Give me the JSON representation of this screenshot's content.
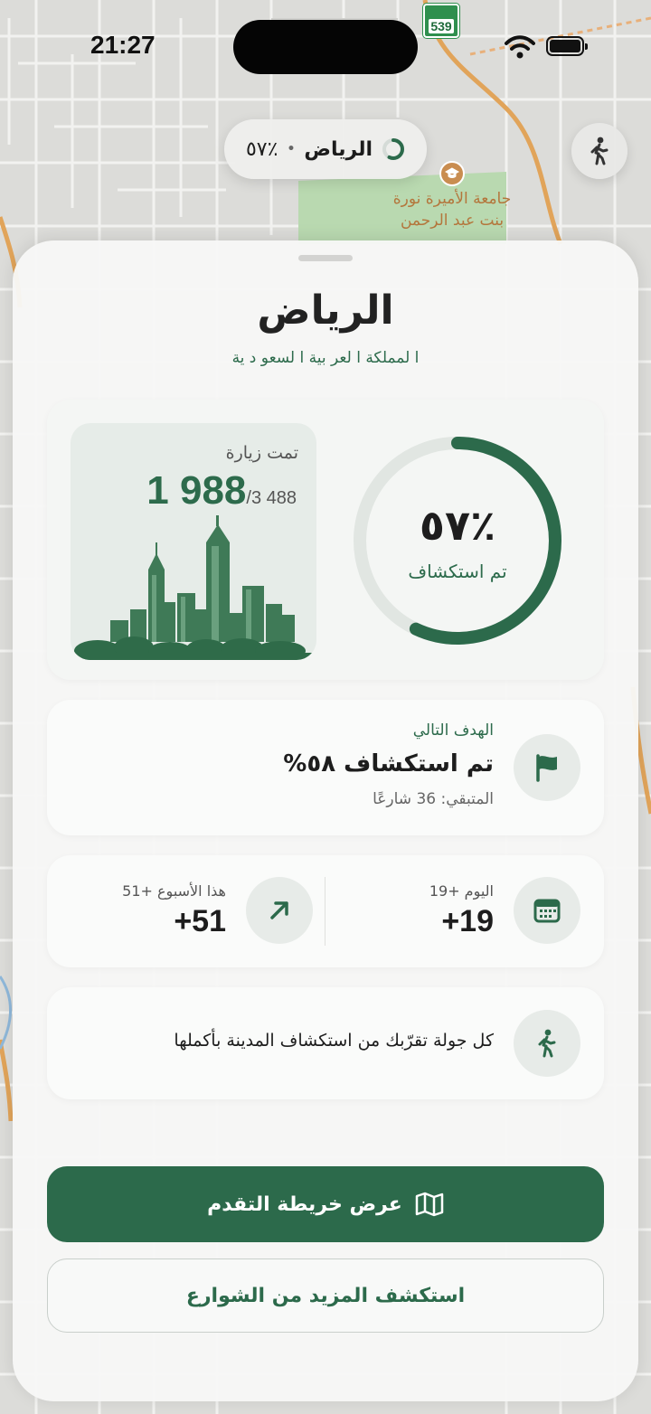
{
  "status_bar": {
    "time": "21:27"
  },
  "map": {
    "road_sign": "539",
    "university_label_line1": "جامعة الأميرة نورة",
    "university_label_line2": "بنت عبد الرحمن"
  },
  "city_pill": {
    "city": "الرياض",
    "separator": "•",
    "percent": "٪٥٧",
    "progress": 0.57
  },
  "sheet": {
    "title": "الرياض",
    "subtitle": "ا لمملكة ا لعر بية ا لسعو د ية",
    "progress": {
      "percent_text": "٪٥٧",
      "label": "تم استكشاف",
      "fraction": 0.57,
      "accent_color": "#2c6a4b",
      "track_color": "#e1e6e2"
    },
    "visited": {
      "label": "تمت زيارة",
      "count": "1 988",
      "total": "/3 488"
    },
    "next_goal": {
      "kicker": "الهدف التالي",
      "title": "تم استكشاف ٥٨%",
      "remaining": "المتبقي: 36 شارعًا",
      "icon": "flag-icon"
    },
    "stats": {
      "today": {
        "label": "اليوم +19",
        "value": "+19",
        "icon": "calendar-icon"
      },
      "week": {
        "label": "هذا الأسبوع +51",
        "value": "+51",
        "icon": "arrow-up-right-icon"
      }
    },
    "tip": {
      "text": "كل جولة تقرّبك من استكشاف المدينة بأكملها",
      "icon": "walking-icon"
    },
    "buttons": {
      "primary": "عرض خريطة التقدم",
      "secondary": "استكشف المزيد من الشوارع"
    }
  }
}
